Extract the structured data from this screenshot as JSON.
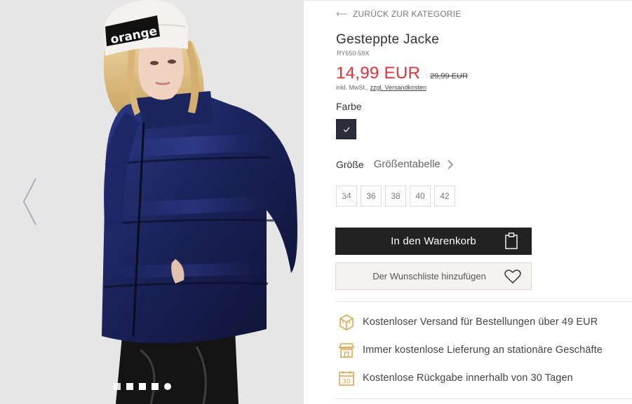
{
  "gallery": {
    "beanie_text": "orange",
    "dots": [
      {
        "shape": "square",
        "active": false
      },
      {
        "shape": "square",
        "active": false
      },
      {
        "shape": "square",
        "active": false
      },
      {
        "shape": "square",
        "active": false
      },
      {
        "shape": "round",
        "active": true
      }
    ]
  },
  "nav": {
    "back_label": "ZURÜCK ZUR KATEGORIE"
  },
  "product": {
    "title": "Gesteppte Jacke",
    "sku": "RY650-59X",
    "price": "14,99 EUR",
    "old_price": "29,99 EUR",
    "tax_prefix": "inkl. MwSt.,",
    "shipping_link": "zzgl. Versandkosten"
  },
  "color": {
    "label": "Farbe",
    "selected_swatch": "#2b2d3a"
  },
  "size": {
    "label": "Größe",
    "table_link": "Größentabelle",
    "options": [
      "34",
      "36",
      "38",
      "40",
      "42"
    ]
  },
  "actions": {
    "cart_label": "In den Warenkorb",
    "wishlist_label": "Der Wunschliste hinzufügen"
  },
  "features": [
    {
      "icon": "shipping-box-icon",
      "text": "Kostenloser Versand für Bestellungen über 49 EUR"
    },
    {
      "icon": "store-icon",
      "text": "Immer kostenlose Lieferung an stationäre Geschäfte"
    },
    {
      "icon": "calendar-30-icon",
      "text": "Kostenlose Rückgabe innerhalb von 30 Tagen"
    }
  ],
  "colors": {
    "accent_gold": "#d7a64a",
    "price_red": "#e2323a",
    "button_dark": "#222222"
  }
}
